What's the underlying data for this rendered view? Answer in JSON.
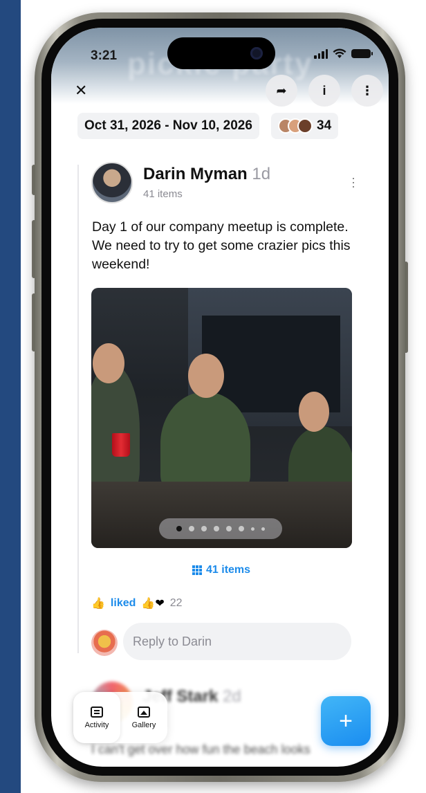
{
  "status_bar": {
    "time": "3:21"
  },
  "header": {
    "ghost_text": "pickle party",
    "close_icon": "close-icon",
    "actions": [
      {
        "icon": "share-icon",
        "glyph": "➦"
      },
      {
        "icon": "info-icon",
        "glyph": "i"
      },
      {
        "icon": "more-vertical-icon",
        "glyph": "⋮"
      }
    ]
  },
  "event": {
    "date_range": "Oct 31, 2026 - Nov 10, 2026",
    "participant_count": "34",
    "participant_colors": [
      "#b98566",
      "#d8a07c",
      "#6b3f2a"
    ]
  },
  "post": {
    "author": "Darin Myman",
    "ago": "1d",
    "item_count": "41 items",
    "text": "Day 1 of our company meetup is complete. We need to try to get some crazier pics this weekend!",
    "carousel_dots": 8,
    "active_dot": 0,
    "items_link": "41 items",
    "liked_label": "liked",
    "reaction_emoji": "👍❤",
    "reaction_count": "22",
    "reply_placeholder": "Reply to Darin"
  },
  "next_post": {
    "author": "Jeff Stark",
    "ago": "2d",
    "text": "I can't get over how fun the beach looks"
  },
  "tabbar": {
    "tabs": [
      {
        "label": "Activity",
        "icon": "newspaper-icon",
        "active": true
      },
      {
        "label": "Gallery",
        "icon": "image-icon",
        "active": false
      }
    ]
  },
  "fab": {
    "label": "+"
  },
  "colors": {
    "accent": "#1c8bea",
    "background": "#23497f"
  }
}
